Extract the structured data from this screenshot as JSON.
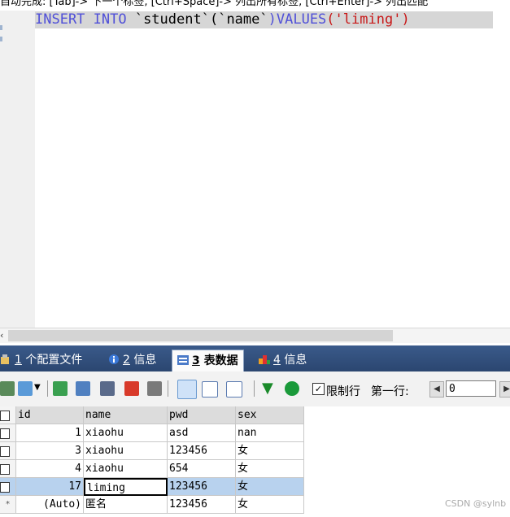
{
  "hint": "自动完成: [Tab]-> 下一个标签, [Ctrl+Space]-> 列出所有标签, [Ctrl+Enter]-> 列出匹配",
  "sql": {
    "kw1": "INSERT INTO ",
    "tbl": "`student`",
    "lp": "(",
    "col": "`name`",
    "rp": ")",
    "kw2": "VALUES",
    "lp2": "(",
    "val": "'liming'",
    "rp2": ")"
  },
  "tabs": [
    {
      "num": "1",
      "label": " 个配置文件",
      "icon": "config-file-icon"
    },
    {
      "num": "2",
      "label": " 信息",
      "icon": "info-icon"
    },
    {
      "num": "3",
      "label": " 表数据",
      "icon": "table-data-icon"
    },
    {
      "num": "4",
      "label": " 信息",
      "icon": "chart-info-icon"
    }
  ],
  "toolbar": {
    "limit_label": "限制行",
    "first_row_label": "第一行:",
    "first_row_value": "0"
  },
  "table": {
    "columns": [
      "id",
      "name",
      "pwd",
      "sex"
    ],
    "rows": [
      [
        "1",
        "xiaohu",
        "asd",
        "nan"
      ],
      [
        "3",
        "xiaohu",
        "123456",
        "女"
      ],
      [
        "4",
        "xiaohu",
        "654",
        "女"
      ],
      [
        "17",
        "liming",
        "123456",
        "女"
      ],
      [
        "(Auto)",
        "匿名",
        "123456",
        "女"
      ]
    ],
    "new_row_marker": "*"
  },
  "watermark": "CSDN @sylnb",
  "colors": {
    "tab_bar": "#2b4670",
    "selected_row": "#b8d2ee",
    "sql_keyword": "#5050d8",
    "sql_string": "#c81818"
  }
}
